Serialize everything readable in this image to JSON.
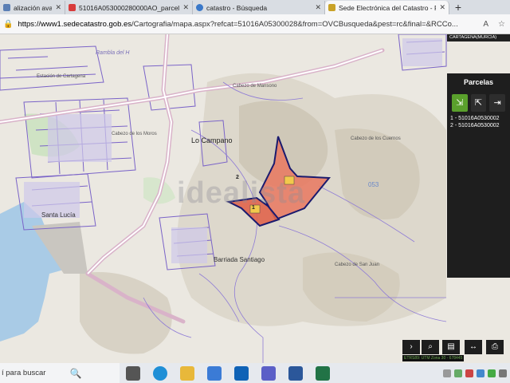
{
  "tabs": [
    {
      "label": "alización avanzada",
      "icon": "app-icon",
      "active": false
    },
    {
      "label": "51016A053000280000AO_parcel",
      "icon": "pdf-icon",
      "active": false
    },
    {
      "label": "catastro - Búsqueda",
      "icon": "search-icon",
      "active": false
    },
    {
      "label": "Sede Electrónica del Catastro - F",
      "icon": "catastro-icon",
      "active": true
    }
  ],
  "address": {
    "url_host": "https://www1.sedecatastro.gob.es",
    "url_path": "/Cartografia/mapa.aspx?refcat=51016A05300028&from=OVCBusqueda&pest=rc&final=&RCCo..."
  },
  "map": {
    "watermark": "idealista",
    "labels": {
      "rambla": "Rambla del H",
      "estacion": "Estación de Cartagena",
      "lo_campano": "Lo Campano",
      "cabezo_mansono": "Cabezo de Mansono",
      "cabezo_cuernos": "Cabezo de los Cuernos",
      "santa_lucia": "Santa Lucía",
      "barriada": "Barriada Santiago",
      "cabezo_san_juan": "Cabezo de San Juan",
      "los_moros": "Cabezo de los Moros",
      "code_053": "053",
      "badge_1": "1",
      "badge_2": "2"
    },
    "region_label": "CARTAGENA(MURCIA)",
    "coords_text": "ETRS89: UTM Zona 30 - 678445"
  },
  "panel": {
    "title": "Parcelas",
    "rows": [
      {
        "num": "1",
        "ref": "51016A0530002"
      },
      {
        "num": "2",
        "ref": "51016A0530002"
      }
    ]
  },
  "taskbar": {
    "search_placeholder": "í para buscar"
  }
}
